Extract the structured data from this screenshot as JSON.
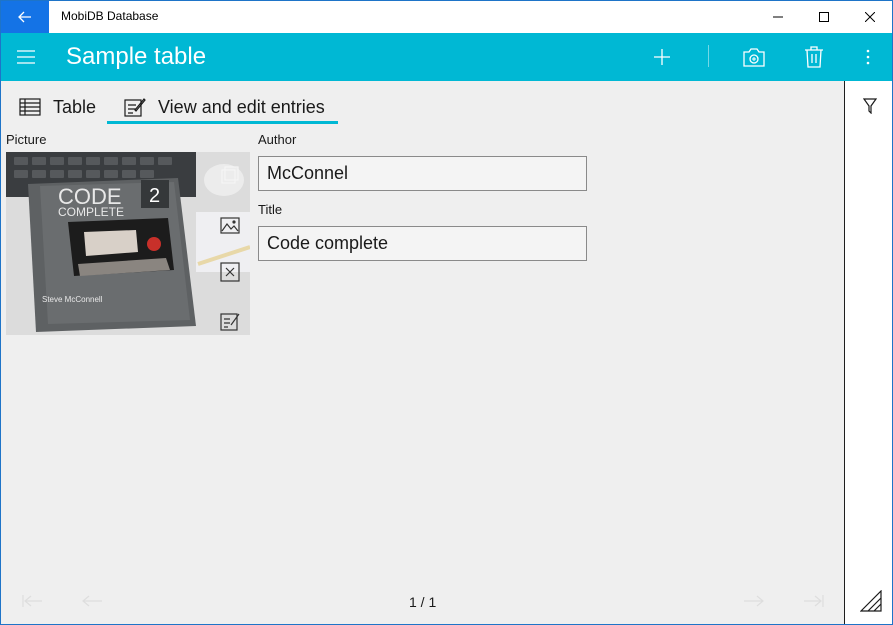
{
  "window": {
    "title": "MobiDB Database"
  },
  "appbar": {
    "title": "Sample table"
  },
  "tabs": [
    {
      "label": "Table",
      "icon": "table-icon",
      "selected": false
    },
    {
      "label": "View and edit entries",
      "icon": "edit-icon",
      "selected": true
    }
  ],
  "form": {
    "picture_label": "Picture",
    "author_label": "Author",
    "author_value": "McConnel",
    "title_label": "Title",
    "title_value": "Code complete"
  },
  "picture": {
    "book_title_line1": "CODE",
    "book_title_line2": "COMPLETE",
    "book_edition": "2",
    "book_author": "Steve McConnell"
  },
  "pager": {
    "text": "1 / 1"
  },
  "colors": {
    "accent": "#00b8d4",
    "back_button": "#1473e6"
  },
  "icons": {
    "back": "back-arrow-icon",
    "menu": "hamburger-icon",
    "add": "plus-icon",
    "camera": "camera-icon",
    "delete": "trash-icon",
    "more": "more-vertical-icon",
    "filter": "filter-icon",
    "resize": "resize-icon"
  }
}
